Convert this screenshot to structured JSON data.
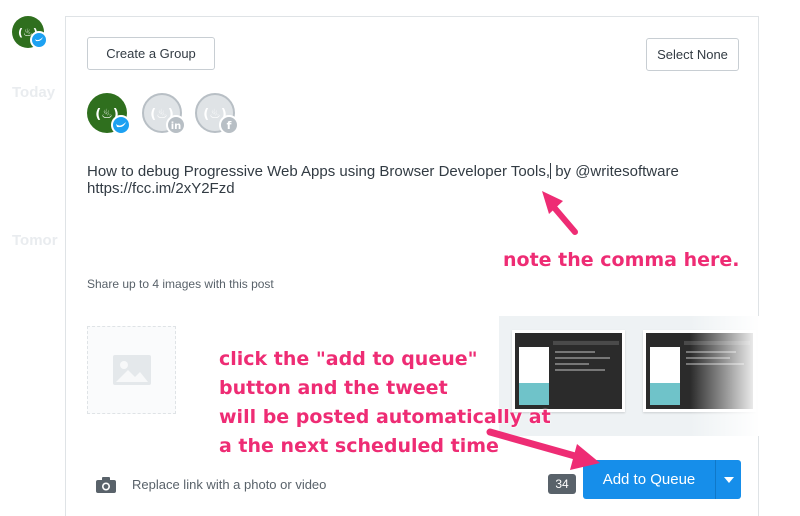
{
  "sidebar": {
    "today_label": "Today",
    "tomorrow_label": "Tomor"
  },
  "composer": {
    "create_group_label": "Create a Group",
    "select_none_label": "Select None",
    "profiles": [
      {
        "network": "twitter",
        "badge_icon": "twitter-icon",
        "selected": true
      },
      {
        "network": "linkedin",
        "badge_icon": "linkedin-icon",
        "selected": false
      },
      {
        "network": "facebook",
        "badge_icon": "facebook-icon",
        "selected": false
      }
    ],
    "text_before_caret": "How to debug Progressive Web Apps using Browser Developer Tools,",
    "text_after_caret": " by @writesoftware",
    "text_line2": "https://fcc.im/2xY2Fzd",
    "share_images_label": "Share up to 4 images with this post",
    "replace_link_label": "Replace link with a photo or video",
    "char_count": "34",
    "add_to_queue_label": "Add to Queue"
  },
  "annotations": {
    "comma_note": "note the comma here.",
    "queue_note_lines": [
      "click the \"add to queue\"",
      "button and the tweet",
      "will be posted automatically at",
      "a the next scheduled time"
    ]
  },
  "colors": {
    "accent": "#168eea",
    "annotation": "#ee2c74",
    "avatar_green": "#2f6f1e",
    "twitter_blue": "#1da1f2",
    "inactive_gray": "#b8bfc5"
  }
}
